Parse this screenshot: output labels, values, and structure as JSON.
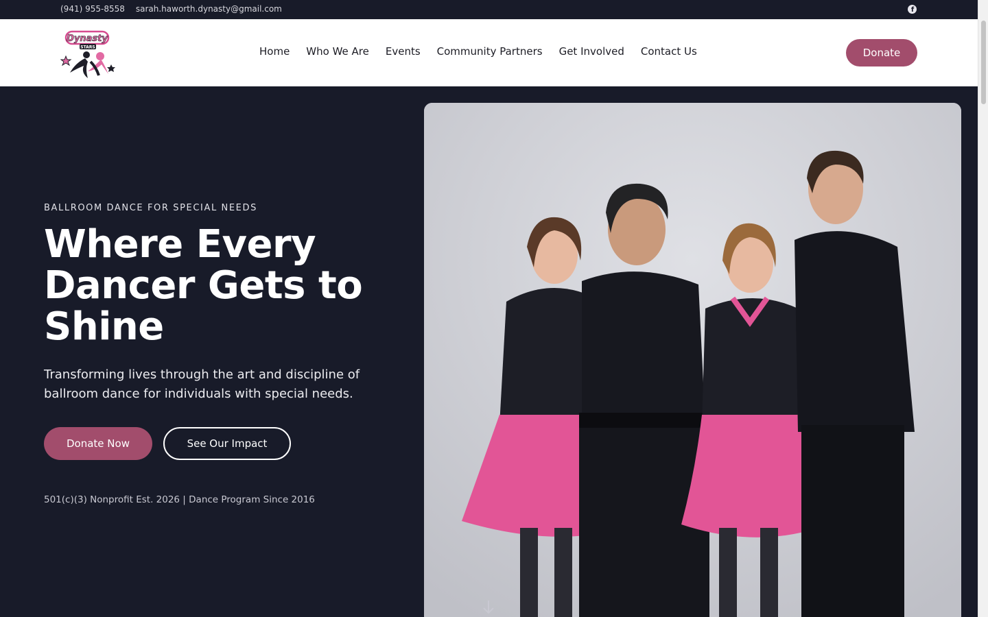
{
  "topbar": {
    "phone": "(941) 955-8558",
    "email": "sarah.haworth.dynasty@gmail.com",
    "social_icon": "facebook-icon"
  },
  "header": {
    "logo_text": "Dynasty",
    "logo_subtext": "STARS",
    "nav": [
      {
        "label": "Home"
      },
      {
        "label": "Who We Are"
      },
      {
        "label": "Events"
      },
      {
        "label": "Community Partners"
      },
      {
        "label": "Get Involved"
      },
      {
        "label": "Contact Us"
      }
    ],
    "donate_label": "Donate"
  },
  "hero": {
    "eyebrow": "BALLROOM DANCE FOR SPECIAL NEEDS",
    "headline_line1": "Where Every",
    "headline_line2": "Dancer Gets to",
    "headline_line3": "Shine",
    "subtext": "Transforming lives through the art and discipline of ballroom dance for individuals with special needs.",
    "primary_cta": "Donate Now",
    "secondary_cta": "See Our Impact",
    "tagline": "501(c)(3) Nonprofit Est. 2026 | Dance Program Since 2016"
  },
  "colors": {
    "accent": "#a24d6c",
    "dark": "#181b29",
    "skirt": "#e25596"
  }
}
